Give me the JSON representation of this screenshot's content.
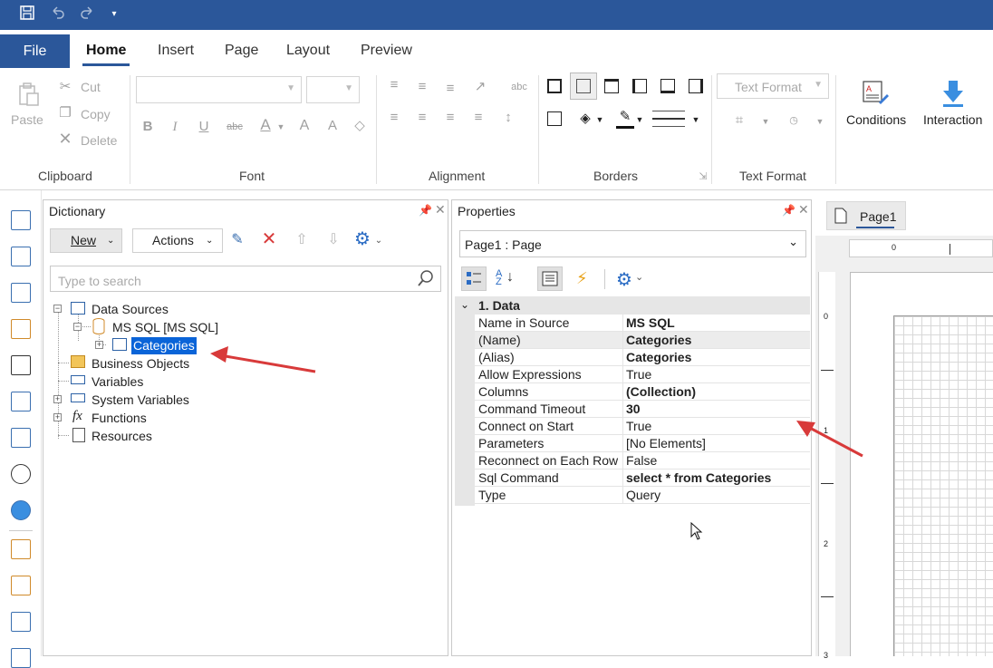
{
  "ribbon": {
    "file_tab": "File",
    "tabs": [
      "Home",
      "Insert",
      "Page",
      "Layout",
      "Preview"
    ],
    "clipboard": {
      "paste": "Paste",
      "cut": "Cut",
      "copy": "Copy",
      "delete": "Delete",
      "label": "Clipboard"
    },
    "font": {
      "label": "Font"
    },
    "alignment": {
      "label": "Alignment"
    },
    "borders": {
      "label": "Borders"
    },
    "text_format": {
      "combo": "Text Format",
      "label": "Text Format"
    },
    "conditions": "Conditions",
    "interaction": "Interaction"
  },
  "dictionary": {
    "title": "Dictionary",
    "new_label": "New",
    "actions_label": "Actions",
    "search_placeholder": "Type to search",
    "tree": {
      "data_sources": "Data Sources",
      "ms_sql": "MS SQL [MS SQL]",
      "categories": "Categories",
      "business_objects": "Business Objects",
      "variables": "Variables",
      "system_variables": "System Variables",
      "functions": "Functions",
      "resources": "Resources"
    }
  },
  "properties": {
    "title": "Properties",
    "object_combo": "Page1 : Page",
    "section": "1. Data",
    "rows": [
      {
        "name": "Name in Source",
        "value": "MS SQL",
        "bold": true
      },
      {
        "name": "(Name)",
        "value": "Categories",
        "bold": true
      },
      {
        "name": "(Alias)",
        "value": "Categories",
        "bold": true
      },
      {
        "name": "Allow Expressions",
        "value": "True",
        "bold": false
      },
      {
        "name": "Columns",
        "value": "(Collection)",
        "bold": true
      },
      {
        "name": "Command Timeout",
        "value": "30",
        "bold": true
      },
      {
        "name": "Connect on Start",
        "value": "True",
        "bold": false
      },
      {
        "name": "Parameters",
        "value": "[No Elements]",
        "bold": false
      },
      {
        "name": "Reconnect on Each Row",
        "value": "False",
        "bold": false
      },
      {
        "name": "Sql Command",
        "value": "select * from Categories",
        "bold": true
      },
      {
        "name": "Type",
        "value": "Query",
        "bold": false
      }
    ]
  },
  "designer": {
    "page_tab": "Page1",
    "ruler_h": [
      "0"
    ],
    "ruler_v": [
      "0",
      "1",
      "2",
      "3"
    ]
  },
  "colors": {
    "accent": "#2b579a",
    "selection": "#0a64d8",
    "arrow": "#d83a3a"
  }
}
